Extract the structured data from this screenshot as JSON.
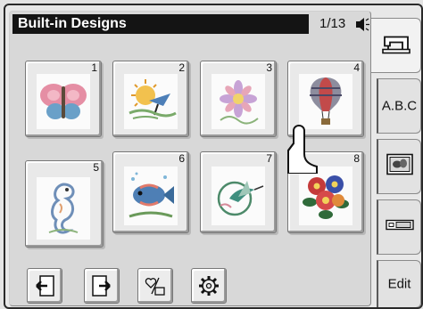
{
  "header": {
    "title": "Built-in Designs",
    "page_indicator": "1/13",
    "sound_icon": "speaker-icon"
  },
  "designs": [
    {
      "number": "1",
      "motif": "butterfly"
    },
    {
      "number": "2",
      "motif": "sun-and-bird"
    },
    {
      "number": "3",
      "motif": "flower-swirl"
    },
    {
      "number": "4",
      "motif": "hot-air-balloon"
    },
    {
      "number": "5",
      "motif": "seahorse"
    },
    {
      "number": "6",
      "motif": "fish"
    },
    {
      "number": "7",
      "motif": "hummingbird"
    },
    {
      "number": "8",
      "motif": "flower-bouquet"
    }
  ],
  "toolbar": {
    "prev_icon": "page-previous-icon",
    "next_icon": "page-next-icon",
    "favorite_icon": "heart-memory-icon",
    "settings_icon": "gear-icon"
  },
  "side_tabs": [
    {
      "id": "sewing-machine",
      "label": "",
      "icon": "sewing-machine-icon"
    },
    {
      "id": "alphabet",
      "label": "A.B.C",
      "icon": ""
    },
    {
      "id": "designs",
      "label": "",
      "icon": "embroidery-design-icon"
    },
    {
      "id": "frame",
      "label": "",
      "icon": "hoop-frame-icon"
    },
    {
      "id": "edit",
      "label": "Edit",
      "icon": ""
    }
  ],
  "colors": {
    "title_bar": "#141414",
    "panel": "#d8d8d8",
    "tile": "#e9e9e9"
  }
}
